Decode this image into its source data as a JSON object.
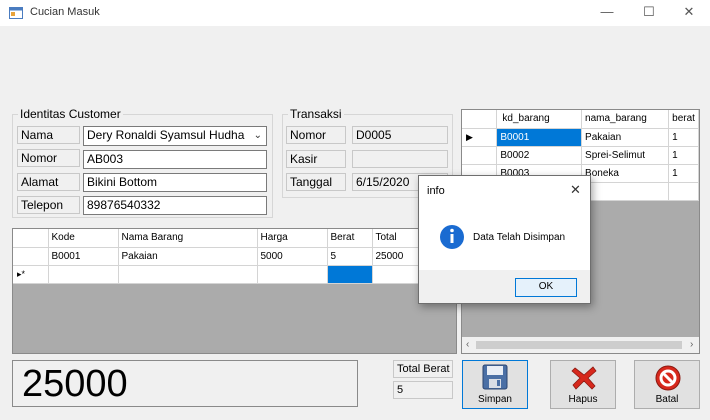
{
  "window": {
    "title": "Cucian Masuk",
    "minimize": "—",
    "maximize": "☐",
    "close": "✕"
  },
  "customer": {
    "legend": "Identitas Customer",
    "fields": [
      {
        "label": "Nama",
        "value": "Dery Ronaldi Syamsul Hudha"
      },
      {
        "label": "Nomor",
        "value": "AB003"
      },
      {
        "label": "Alamat",
        "value": "Bikini Bottom"
      },
      {
        "label": "Telepon",
        "value": "89876540332"
      }
    ]
  },
  "transaksi": {
    "legend": "Transaksi",
    "fields": [
      {
        "label": "Nomor",
        "value": "D0005"
      },
      {
        "label": "Kasir",
        "value": ""
      },
      {
        "label": "Tanggal",
        "value": "6/15/2020"
      }
    ]
  },
  "detail_grid": {
    "columns": [
      "Kode",
      "Nama Barang",
      "Harga",
      "Berat",
      "Total"
    ],
    "rows": [
      {
        "kode": "B0001",
        "nama": "Pakaian",
        "harga": "5000",
        "berat": "5",
        "total": "25000"
      }
    ],
    "new_row_marker": "▸*"
  },
  "barang_grid": {
    "columns": [
      "kd_barang",
      "nama_barang",
      "berat"
    ],
    "rows": [
      {
        "kd": "B0001",
        "nama": "Pakaian",
        "berat": "1"
      },
      {
        "kd": "B0002",
        "nama": "Sprei-Selimut",
        "berat": "1"
      },
      {
        "kd": "B0003",
        "nama": "Boneka",
        "berat": "1"
      }
    ],
    "current_row_marker": "▶"
  },
  "total": {
    "value": "25000"
  },
  "total_berat": {
    "label": "Total Berat",
    "value": "5"
  },
  "buttons": {
    "simpan": "Simpan",
    "hapus": "Hapus",
    "batal": "Batal"
  },
  "dialog": {
    "title": "info",
    "message": "Data Telah Disimpan",
    "ok": "OK",
    "close": "✕"
  },
  "colors": {
    "selection": "#0078d7",
    "grid_bg": "#ababab",
    "icon_blue": "#1a6bd1",
    "delete_red": "#d7281c"
  }
}
